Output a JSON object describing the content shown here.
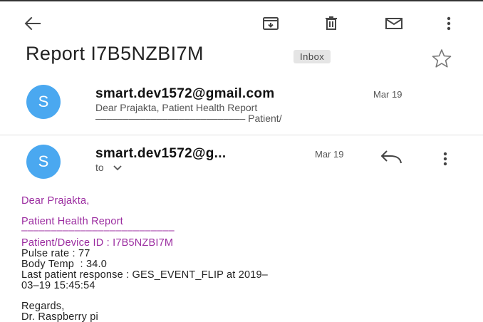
{
  "toolbar": {
    "back_icon": "back-arrow-icon",
    "archive_icon": "archive-icon",
    "delete_icon": "trash-icon",
    "mail_icon": "mail-icon",
    "more_icon": "more-vert-icon"
  },
  "subject": {
    "title": "Report I7B5NZBI7M",
    "label": "Inbox"
  },
  "messages": [
    {
      "avatar_letter": "S",
      "sender": "smart.dev1572@gmail.com",
      "date": "Mar 19",
      "snippet_line1": "Dear Prajakta, Patient Health Report",
      "snippet_line2": "––––––––––––––––––––––––––– Patient/"
    },
    {
      "avatar_letter": "S",
      "sender": "smart.dev1572@g...",
      "date": "Mar 19",
      "to_label": "to"
    }
  ],
  "body": {
    "greeting": "Dear Prajakta,",
    "heading": "Patient Health Report",
    "rule": "––––––––––––––––––––––––––",
    "device_id": "Patient/Device ID : I7B5NZBI7M",
    "pulse": "Pulse rate : 77",
    "temp": "Body Temp  : 34.0",
    "response_line1": "Last patient response : GES_EVENT_FLIP at 2019–",
    "response_line2": "03–19 15:45:54",
    "regards": "Regards,",
    "signature": "Dr. Raspberry pi"
  },
  "colors": {
    "avatar": "#4aa8f0",
    "body_accent": "#9b2ca0"
  }
}
